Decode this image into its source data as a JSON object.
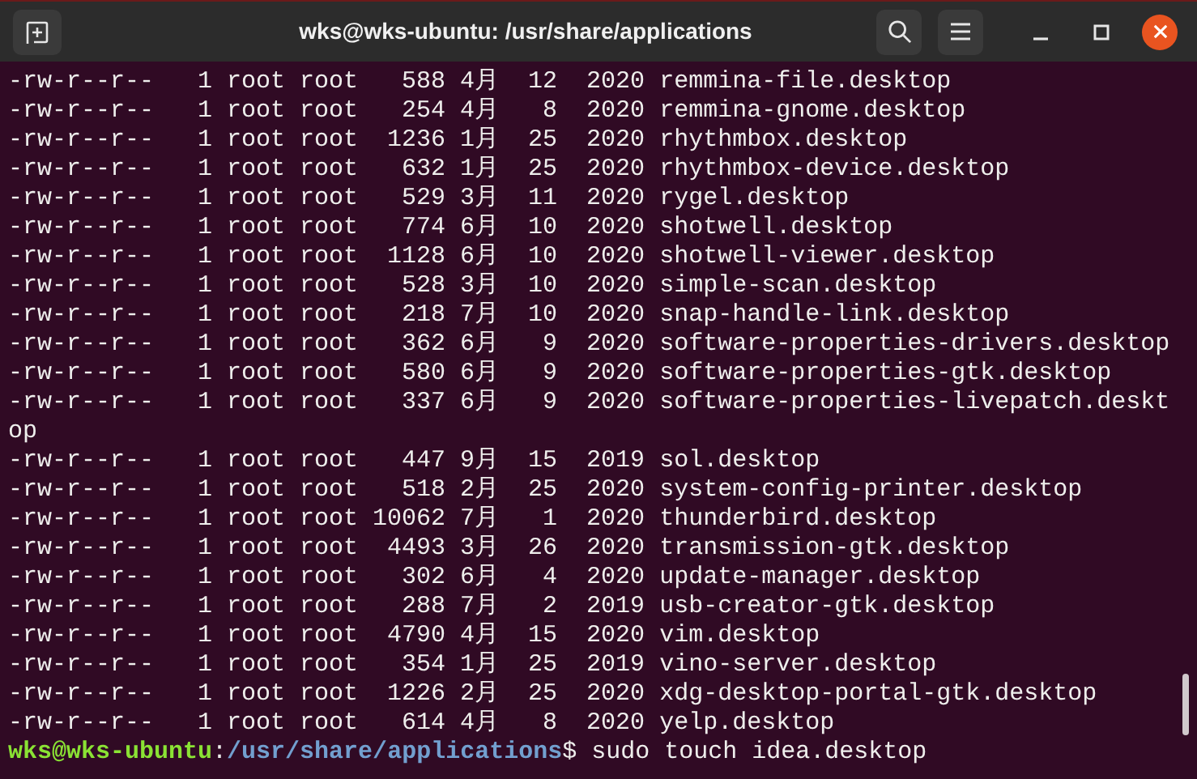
{
  "window": {
    "title": "wks@wks-ubuntu: /usr/share/applications"
  },
  "output_lines": [
    "-rw-r--r--   1 root root   588 4月  12  2020 remmina-file.desktop",
    "-rw-r--r--   1 root root   254 4月   8  2020 remmina-gnome.desktop",
    "-rw-r--r--   1 root root  1236 1月  25  2020 rhythmbox.desktop",
    "-rw-r--r--   1 root root   632 1月  25  2020 rhythmbox-device.desktop",
    "-rw-r--r--   1 root root   529 3月  11  2020 rygel.desktop",
    "-rw-r--r--   1 root root   774 6月  10  2020 shotwell.desktop",
    "-rw-r--r--   1 root root  1128 6月  10  2020 shotwell-viewer.desktop",
    "-rw-r--r--   1 root root   528 3月  10  2020 simple-scan.desktop",
    "-rw-r--r--   1 root root   218 7月  10  2020 snap-handle-link.desktop",
    "-rw-r--r--   1 root root   362 6月   9  2020 software-properties-drivers.desktop",
    "-rw-r--r--   1 root root   580 6月   9  2020 software-properties-gtk.desktop",
    "-rw-r--r--   1 root root   337 6月   9  2020 software-properties-livepatch.deskt",
    "op",
    "-rw-r--r--   1 root root   447 9月  15  2019 sol.desktop",
    "-rw-r--r--   1 root root   518 2月  25  2020 system-config-printer.desktop",
    "-rw-r--r--   1 root root 10062 7月   1  2020 thunderbird.desktop",
    "-rw-r--r--   1 root root  4493 3月  26  2020 transmission-gtk.desktop",
    "-rw-r--r--   1 root root   302 6月   4  2020 update-manager.desktop",
    "-rw-r--r--   1 root root   288 7月   2  2019 usb-creator-gtk.desktop",
    "-rw-r--r--   1 root root  4790 4月  15  2020 vim.desktop",
    "-rw-r--r--   1 root root   354 1月  25  2019 vino-server.desktop",
    "-rw-r--r--   1 root root  1226 2月  25  2020 xdg-desktop-portal-gtk.desktop",
    "-rw-r--r--   1 root root   614 4月   8  2020 yelp.desktop"
  ],
  "prompt": [
    {
      "kind": "user",
      "text": "wks@wks-ubuntu"
    },
    {
      "kind": "plain",
      "text": ":"
    },
    {
      "kind": "path",
      "text": "/usr/share/applications"
    },
    {
      "kind": "plain",
      "text": "$ sudo touch idea.desktop"
    }
  ]
}
